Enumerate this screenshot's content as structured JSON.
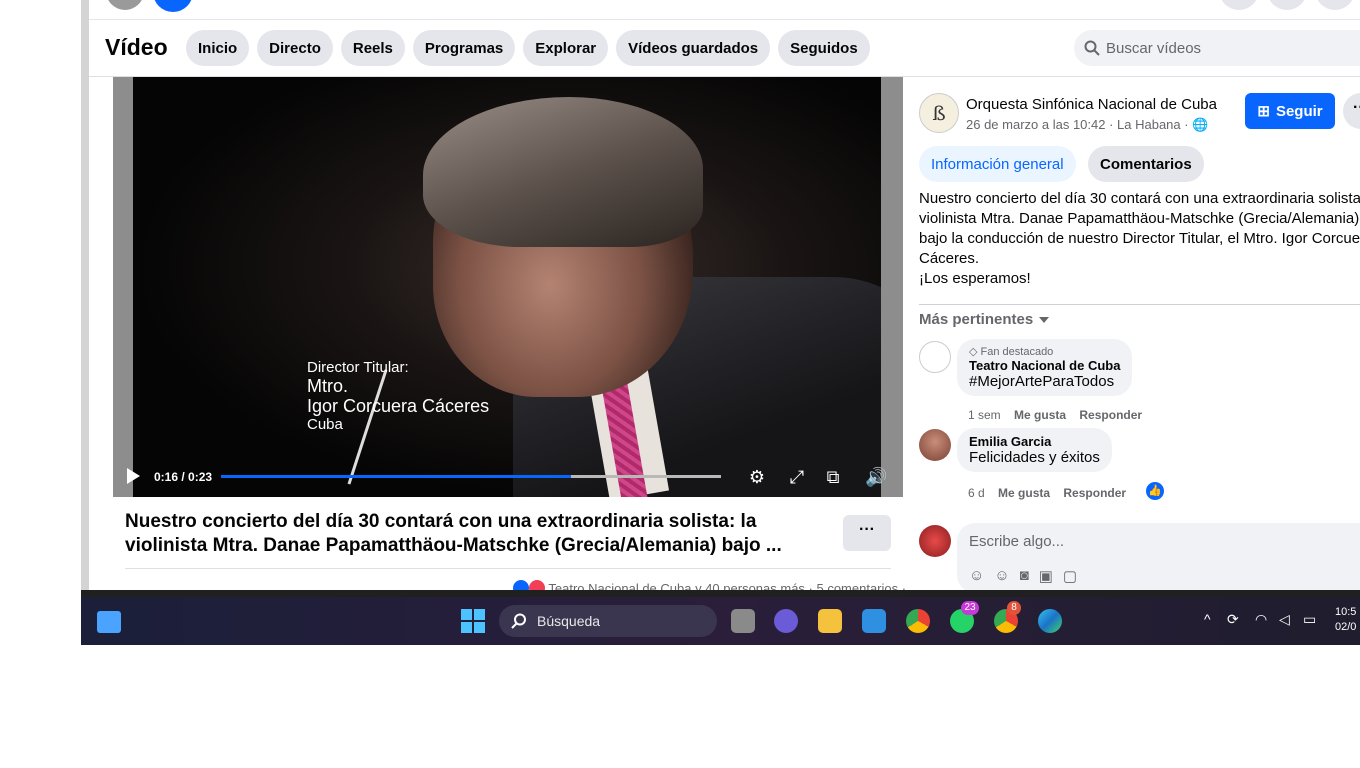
{
  "nav": {
    "title": "Vídeo",
    "tabs": [
      "Inicio",
      "Directo",
      "Reels",
      "Programas",
      "Explorar",
      "Vídeos guardados",
      "Seguidos"
    ],
    "search_placeholder": "Buscar vídeos"
  },
  "video": {
    "caption": [
      "Director Titular:",
      "Mtro.",
      "Igor Corcuera Cáceres",
      "Cuba"
    ],
    "time": "0:16 / 0:23",
    "progress_fraction": 0.7,
    "title": "Nuestro concierto del día 30 contará con una extraordinaria solista: la violinista Mtra. Danae Papamatthäou-Matschke (Grecia/Alemania) bajo ...",
    "reactions_text": "Teatro Nacional de Cuba y 40 personas más · 5 comentarios ·"
  },
  "post": {
    "page_name": "Orquesta Sinfónica Nacional de Cuba",
    "page_sub": "26 de marzo a las 10:42 · La Habana ·",
    "follow_label": "Seguir",
    "tab_info": "Información general",
    "tab_comments": "Comentarios",
    "description": [
      "Nuestro concierto del día 30 contará con una extraordinaria solista:",
      "violinista Mtra. Danae Papamatthäou-Matschke (Grecia/Alemania)",
      "bajo la conducción de nuestro Director Titular, el Mtro. Igor Corcue",
      "Cáceres.",
      "¡Los esperamos!"
    ],
    "relevant_label": "Más pertinentes"
  },
  "comments": [
    {
      "badge": "Fan destacado",
      "name": "Teatro Nacional de Cuba",
      "text": "#MejorArteParaTodos",
      "time": "1 sem",
      "like": "Me gusta",
      "reply": "Responder"
    },
    {
      "name": "Emilia Garcia",
      "text": "Felicidades y éxitos",
      "time": "6 d",
      "like": "Me gusta",
      "reply": "Responder"
    }
  ],
  "composer": {
    "placeholder": "Escribe algo..."
  },
  "taskbar": {
    "search_label": "Búsqueda",
    "whatsapp_badge": "23",
    "chrome_badge": "8",
    "clock_time": "10:5",
    "clock_date": "02/0"
  },
  "colors": {
    "fb_blue": "#0866ff",
    "comment_bg": "#f0f2f5"
  }
}
